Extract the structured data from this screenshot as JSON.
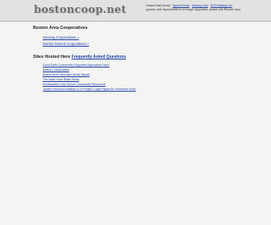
{
  "header": {
    "logo": "bostoncoop.net",
    "hosted_mail_prefix": "Hosted Mail (local) ·",
    "links": [
      "SquirrelCube",
      "Mailing Lists",
      "BCN Mailing List"
    ],
    "notice": "(please note SquirrelMail is no longer supported, please use RoundCube)"
  },
  "boston_coops": {
    "title": "Boston Area Cooperatives",
    "links": [
      "Housing Cooperatives »",
      "Worker-Owned Cooperatives »"
    ]
  },
  "sites_hosted": {
    "title": "Sites Hosted Here",
    "faq_label": "Frequently Asked Questions",
    "links": [
      "Good Earth Community Supported Agriculture Farm",
      "Boston Critical Mass",
      "Boston Area Liberation Music Squad",
      "The Israel Hour Radio Show",
      "Northeastern Law School Community Resources",
      "Justice Resource Institute LCS Project: Legal Rights for Homeless Youth"
    ]
  }
}
